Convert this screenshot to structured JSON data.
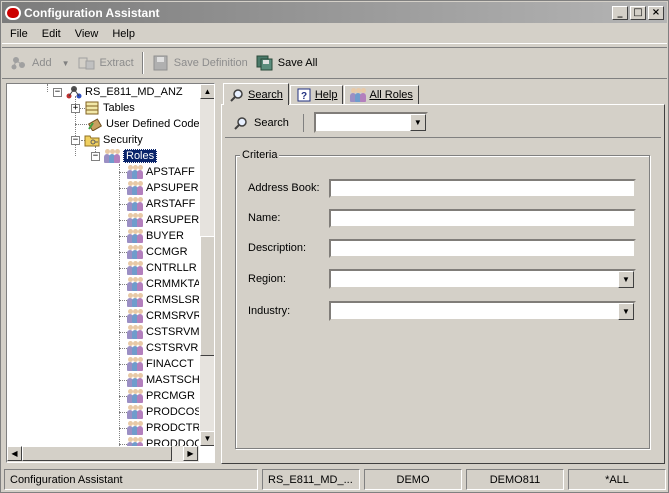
{
  "window": {
    "title": "Configuration Assistant",
    "controls": [
      "_",
      "□",
      "×"
    ]
  },
  "menu": [
    "File",
    "Edit",
    "View",
    "Help"
  ],
  "toolbar": {
    "add_label": "Add",
    "extract_label": "Extract",
    "save_definition_label": "Save Definition",
    "save_all_label": "Save All"
  },
  "tree": {
    "root": "RS_E811_MD_ANZ",
    "tables": "Tables",
    "udc": "User Defined Codes",
    "security": "Security",
    "roles": "Roles",
    "role_items": [
      "APSTAFF",
      "APSUPER",
      "ARSTAFF",
      "ARSUPER",
      "BUYER",
      "CCMGR",
      "CNTRLLR",
      "CRMMKTADM",
      "CRMSLSREP",
      "CRMSRVREP",
      "CSTSRVMGR",
      "CSTSRVREP",
      "FINACCT",
      "MASTSCHED",
      "PRCMGR",
      "PRODCOST",
      "PRODCTRL",
      "PRODDOC"
    ]
  },
  "tabs": {
    "search": "Search",
    "help": "Help",
    "all_roles": "All Roles"
  },
  "search_panel": {
    "search_button": "Search",
    "combo_value": "",
    "criteria_label": "Criteria",
    "fields": {
      "address_book_label": "Address Book:",
      "name_label": "Name:",
      "description_label": "Description:",
      "region_label": "Region:",
      "industry_label": "Industry:"
    }
  },
  "status": {
    "app": "Configuration Assistant",
    "env": "RS_E811_MD_...",
    "user": "DEMO",
    "path": "DEMO811",
    "role": "*ALL"
  }
}
